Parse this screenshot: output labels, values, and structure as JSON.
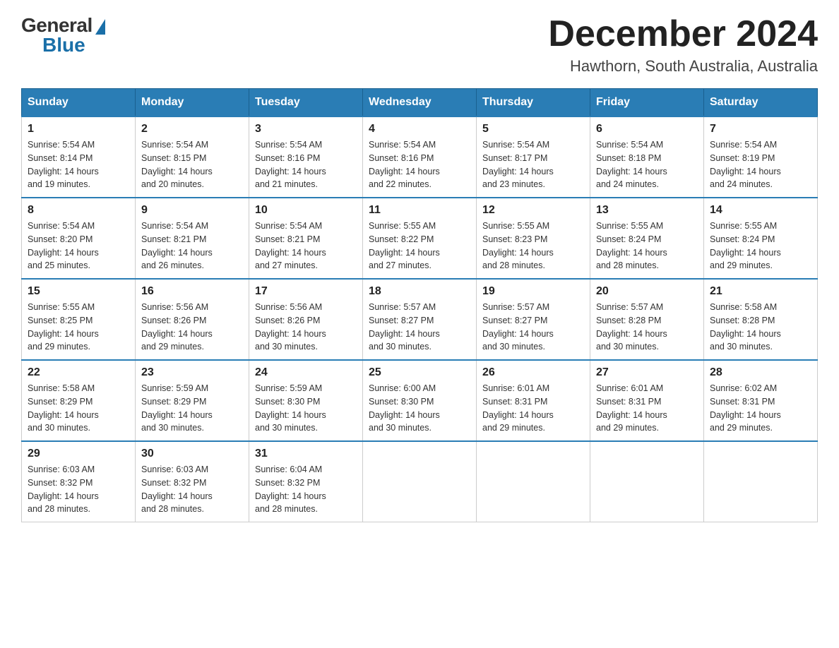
{
  "header": {
    "logo": {
      "general": "General",
      "blue": "Blue"
    },
    "title": "December 2024",
    "location": "Hawthorn, South Australia, Australia"
  },
  "days_of_week": [
    "Sunday",
    "Monday",
    "Tuesday",
    "Wednesday",
    "Thursday",
    "Friday",
    "Saturday"
  ],
  "weeks": [
    [
      {
        "day": "1",
        "sunrise": "5:54 AM",
        "sunset": "8:14 PM",
        "daylight": "14 hours and 19 minutes."
      },
      {
        "day": "2",
        "sunrise": "5:54 AM",
        "sunset": "8:15 PM",
        "daylight": "14 hours and 20 minutes."
      },
      {
        "day": "3",
        "sunrise": "5:54 AM",
        "sunset": "8:16 PM",
        "daylight": "14 hours and 21 minutes."
      },
      {
        "day": "4",
        "sunrise": "5:54 AM",
        "sunset": "8:16 PM",
        "daylight": "14 hours and 22 minutes."
      },
      {
        "day": "5",
        "sunrise": "5:54 AM",
        "sunset": "8:17 PM",
        "daylight": "14 hours and 23 minutes."
      },
      {
        "day": "6",
        "sunrise": "5:54 AM",
        "sunset": "8:18 PM",
        "daylight": "14 hours and 24 minutes."
      },
      {
        "day": "7",
        "sunrise": "5:54 AM",
        "sunset": "8:19 PM",
        "daylight": "14 hours and 24 minutes."
      }
    ],
    [
      {
        "day": "8",
        "sunrise": "5:54 AM",
        "sunset": "8:20 PM",
        "daylight": "14 hours and 25 minutes."
      },
      {
        "day": "9",
        "sunrise": "5:54 AM",
        "sunset": "8:21 PM",
        "daylight": "14 hours and 26 minutes."
      },
      {
        "day": "10",
        "sunrise": "5:54 AM",
        "sunset": "8:21 PM",
        "daylight": "14 hours and 27 minutes."
      },
      {
        "day": "11",
        "sunrise": "5:55 AM",
        "sunset": "8:22 PM",
        "daylight": "14 hours and 27 minutes."
      },
      {
        "day": "12",
        "sunrise": "5:55 AM",
        "sunset": "8:23 PM",
        "daylight": "14 hours and 28 minutes."
      },
      {
        "day": "13",
        "sunrise": "5:55 AM",
        "sunset": "8:24 PM",
        "daylight": "14 hours and 28 minutes."
      },
      {
        "day": "14",
        "sunrise": "5:55 AM",
        "sunset": "8:24 PM",
        "daylight": "14 hours and 29 minutes."
      }
    ],
    [
      {
        "day": "15",
        "sunrise": "5:55 AM",
        "sunset": "8:25 PM",
        "daylight": "14 hours and 29 minutes."
      },
      {
        "day": "16",
        "sunrise": "5:56 AM",
        "sunset": "8:26 PM",
        "daylight": "14 hours and 29 minutes."
      },
      {
        "day": "17",
        "sunrise": "5:56 AM",
        "sunset": "8:26 PM",
        "daylight": "14 hours and 30 minutes."
      },
      {
        "day": "18",
        "sunrise": "5:57 AM",
        "sunset": "8:27 PM",
        "daylight": "14 hours and 30 minutes."
      },
      {
        "day": "19",
        "sunrise": "5:57 AM",
        "sunset": "8:27 PM",
        "daylight": "14 hours and 30 minutes."
      },
      {
        "day": "20",
        "sunrise": "5:57 AM",
        "sunset": "8:28 PM",
        "daylight": "14 hours and 30 minutes."
      },
      {
        "day": "21",
        "sunrise": "5:58 AM",
        "sunset": "8:28 PM",
        "daylight": "14 hours and 30 minutes."
      }
    ],
    [
      {
        "day": "22",
        "sunrise": "5:58 AM",
        "sunset": "8:29 PM",
        "daylight": "14 hours and 30 minutes."
      },
      {
        "day": "23",
        "sunrise": "5:59 AM",
        "sunset": "8:29 PM",
        "daylight": "14 hours and 30 minutes."
      },
      {
        "day": "24",
        "sunrise": "5:59 AM",
        "sunset": "8:30 PM",
        "daylight": "14 hours and 30 minutes."
      },
      {
        "day": "25",
        "sunrise": "6:00 AM",
        "sunset": "8:30 PM",
        "daylight": "14 hours and 30 minutes."
      },
      {
        "day": "26",
        "sunrise": "6:01 AM",
        "sunset": "8:31 PM",
        "daylight": "14 hours and 29 minutes."
      },
      {
        "day": "27",
        "sunrise": "6:01 AM",
        "sunset": "8:31 PM",
        "daylight": "14 hours and 29 minutes."
      },
      {
        "day": "28",
        "sunrise": "6:02 AM",
        "sunset": "8:31 PM",
        "daylight": "14 hours and 29 minutes."
      }
    ],
    [
      {
        "day": "29",
        "sunrise": "6:03 AM",
        "sunset": "8:32 PM",
        "daylight": "14 hours and 28 minutes."
      },
      {
        "day": "30",
        "sunrise": "6:03 AM",
        "sunset": "8:32 PM",
        "daylight": "14 hours and 28 minutes."
      },
      {
        "day": "31",
        "sunrise": "6:04 AM",
        "sunset": "8:32 PM",
        "daylight": "14 hours and 28 minutes."
      },
      null,
      null,
      null,
      null
    ]
  ],
  "labels": {
    "sunrise": "Sunrise:",
    "sunset": "Sunset:",
    "daylight": "Daylight:"
  }
}
